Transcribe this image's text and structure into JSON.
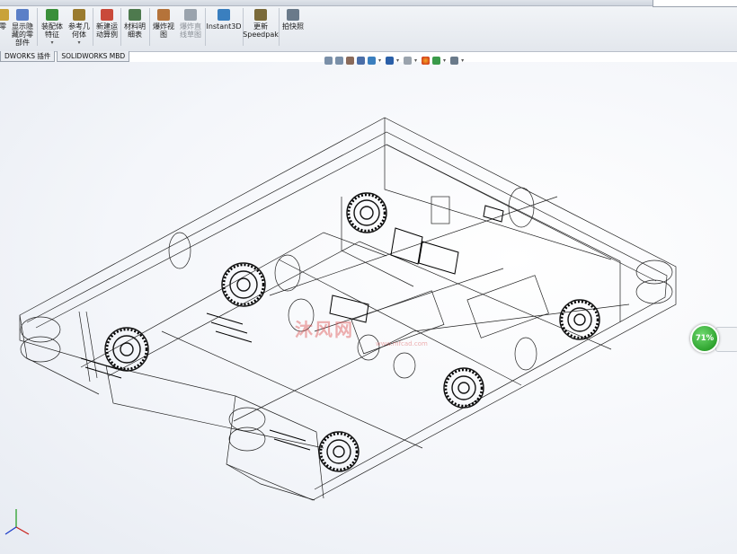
{
  "ribbon": {
    "buttons": [
      {
        "id": "part",
        "label": "零",
        "icon_color": "#c9a23a"
      },
      {
        "id": "show-hidden",
        "label": "显示隐\n藏的零\n部件",
        "icon_color": "#5b7fc7"
      },
      {
        "id": "assembly-feature",
        "label": "装配体\n特征",
        "icon_color": "#3a8f3a",
        "dropdown": "▾"
      },
      {
        "id": "ref-geometry",
        "label": "参考几\n何体",
        "icon_color": "#9a7b2f",
        "dropdown": "▾"
      },
      {
        "id": "new-motion",
        "label": "新建运\n动算例",
        "icon_color": "#c94a3a"
      },
      {
        "id": "bom",
        "label": "材料明\n细表",
        "icon_color": "#4e7a4e"
      },
      {
        "id": "exploded-view",
        "label": "爆炸视\n图",
        "icon_color": "#b5733a"
      },
      {
        "id": "explode-line",
        "label": "爆炸直\n线草图",
        "icon_color": "#9aa3ad"
      },
      {
        "id": "instant3d",
        "label": "Instant3D",
        "icon_color": "#3a7fbf"
      },
      {
        "id": "speedpak",
        "label": "更新\nSpeedpak",
        "icon_color": "#7a6a3a"
      },
      {
        "id": "snapshot",
        "label": "拍快照",
        "icon_color": "#6a7a8a"
      }
    ]
  },
  "tabs": [
    "DWORKS 插件",
    "SOLIDWORKS MBD"
  ],
  "hud_icons": [
    "zoom-fit-icon",
    "zoom-area-icon",
    "previous-view-icon",
    "section-view-icon",
    "view-orientation-icon",
    "display-style-icon",
    "hide-show-icon",
    "edit-appearance-icon",
    "apply-scene-icon",
    "view-settings-icon"
  ],
  "watermark": {
    "text": "沐风网",
    "url": "www.mfcad.com"
  },
  "gauge": {
    "value": "71%"
  },
  "colors": {
    "accent": "#2fa42f",
    "ribbon": "#e8ebf0"
  }
}
